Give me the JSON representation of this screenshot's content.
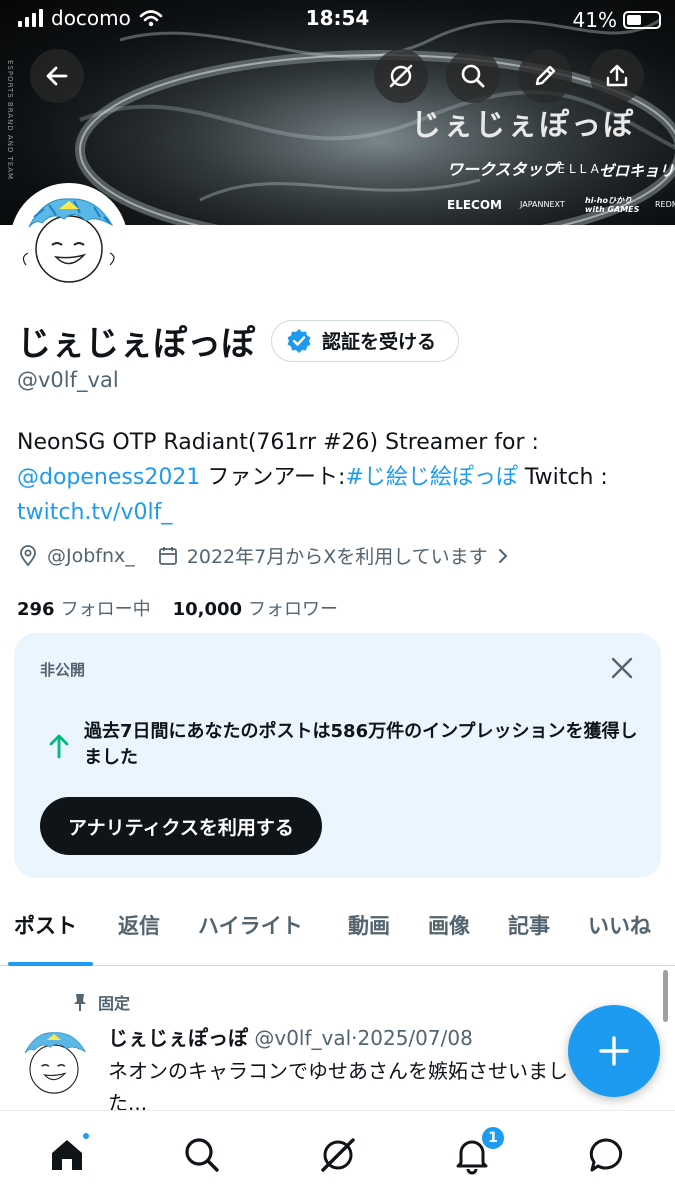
{
  "status_bar": {
    "carrier": "docomo",
    "time": "18:54",
    "battery": "41%"
  },
  "banner": {
    "title": "じぇじぇぽっぽ",
    "side_text": "ESPORTS BRAND AND TEAM",
    "sponsors": [
      "ワークスタップ",
      "CELLA",
      "ゼロキョリ",
      "ELECOM",
      "JAPANNEXT",
      "hi-hoひかり with GAMES",
      "REDMAGIC"
    ]
  },
  "profile": {
    "display_name": "じぇじぇぽっぽ",
    "verify_label": "認証を受ける",
    "handle": "@v0lf_val",
    "bio_text1": "NeonSG OTP Radiant(761rr #26) Streamer for :",
    "bio_link1": "@dopeness2021",
    "bio_text2": " ファンアート:",
    "bio_link2": "#じ絵じ絵ぽっぽ",
    "bio_text3": " Twitch :",
    "bio_link3": "twitch.tv/v0lf_",
    "location": "@Jobfnx_",
    "joined": "2022年7月からXを利用しています",
    "following_count": "296",
    "following_label": "フォロー中",
    "followers_count": "10,000",
    "followers_label": "フォロワー"
  },
  "analytics_card": {
    "private_label": "非公開",
    "message": "過去7日間にあなたのポストは586万件のインプレッションを獲得しました",
    "cta_label": "アナリティクスを利用する"
  },
  "tabs": [
    "ポスト",
    "返信",
    "ハイライト",
    "動画",
    "画像",
    "記事",
    "いいね"
  ],
  "post": {
    "pinned_label": "固定",
    "name": "じぇじぇぽっぽ",
    "handle": "@v0lf_val",
    "separator": "·",
    "date": "2025/07/08",
    "text": "ネオンのキャラコンでゆせあさんを嫉妬させいました..."
  },
  "nav": {
    "notifications_badge": "1"
  },
  "icons": [
    "back-arrow-icon",
    "grok-icon",
    "search-icon",
    "edit-pencil-icon",
    "share-icon",
    "verified-badge-icon",
    "location-icon",
    "calendar-icon",
    "chevron-right-icon",
    "close-icon",
    "arrow-up-icon",
    "pin-icon",
    "plus-icon",
    "home-icon",
    "bell-icon",
    "chat-bubble-icon"
  ],
  "colors": {
    "accent": "#1d9bf0",
    "text": "#0f1419",
    "secondary": "#536471",
    "card_bg": "#eaf5fd",
    "up_arrow": "#00ba7c"
  }
}
